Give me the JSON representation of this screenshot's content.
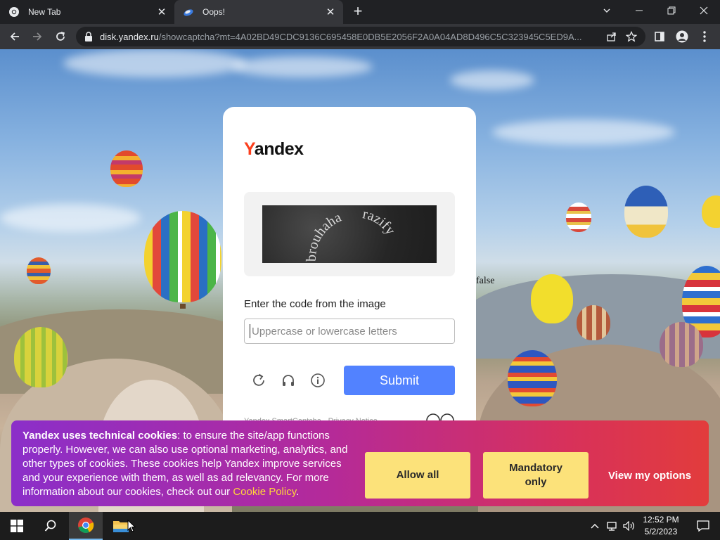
{
  "browser": {
    "tabs": [
      {
        "title": "New Tab",
        "icon": "chrome-icon",
        "active": false
      },
      {
        "title": "Oops!",
        "icon": "yandex-disk-icon",
        "active": true
      }
    ],
    "url_host": "disk.yandex.ru",
    "url_path": "/showcaptcha?mt=4A02BD49CDC9136C695458E0DB5E2056F2A0A04AD8D496C5C323945C5ED9A..."
  },
  "page": {
    "stray_text": "false",
    "logo": {
      "first": "Y",
      "rest": "andex"
    },
    "captcha_words": [
      "brouhaha",
      "razify"
    ],
    "instruction": "Enter the code from the image",
    "input": {
      "value": "",
      "placeholder": "Uppercase or lowercase letters"
    },
    "submit_label": "Submit",
    "footer_text": "Yandex SmartCaptcha · Privacy Notice"
  },
  "cookie_banner": {
    "title": "Yandex uses technical cookies",
    "body": ": to ensure the site/app functions properly. However, we can also use optional marketing, analytics, and other types of cookies. These cookies help Yandex improve services and your experience with them, as well as ad relevancy. For more information about our cookies, check out our ",
    "link": "Cookie Policy",
    "end": ".",
    "allow_all": "Allow all",
    "mandatory_only": "Mandatory only",
    "view_options": "View my options"
  },
  "taskbar": {
    "time": "12:52 PM",
    "date": "5/2/2023"
  },
  "colors": {
    "yandex_red": "#fc3f1d",
    "submit_blue": "#5282ff",
    "cookie_button": "#fce27a",
    "cookie_link": "#ffd43b"
  }
}
